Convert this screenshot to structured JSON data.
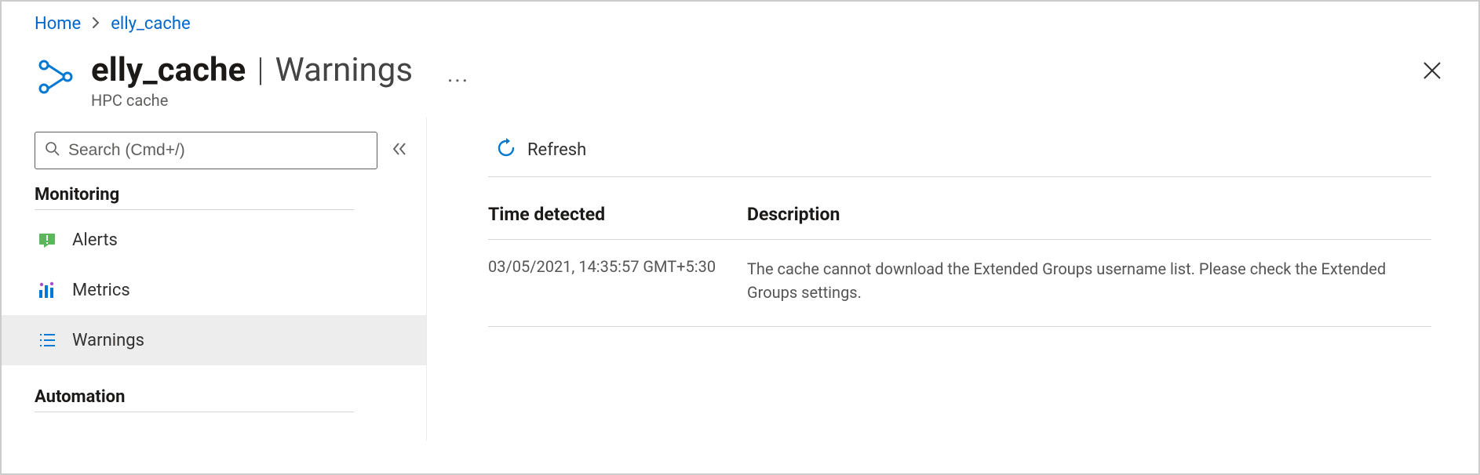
{
  "breadcrumb": {
    "home": "Home",
    "resource": "elly_cache"
  },
  "header": {
    "resource_name": "elly_cache",
    "section": "Warnings",
    "resource_type": "HPC cache",
    "more": "..."
  },
  "search": {
    "placeholder": "Search (Cmd+/)"
  },
  "sidebar": {
    "section_monitoring": "Monitoring",
    "section_automation": "Automation",
    "items": {
      "alerts": "Alerts",
      "metrics": "Metrics",
      "warnings": "Warnings"
    }
  },
  "toolbar": {
    "refresh": "Refresh"
  },
  "table": {
    "headers": {
      "time": "Time detected",
      "description": "Description"
    },
    "rows": [
      {
        "time": "03/05/2021, 14:35:57 GMT+5:30",
        "description": "The cache cannot download the Extended Groups username list. Please check the Extended Groups settings."
      }
    ]
  }
}
